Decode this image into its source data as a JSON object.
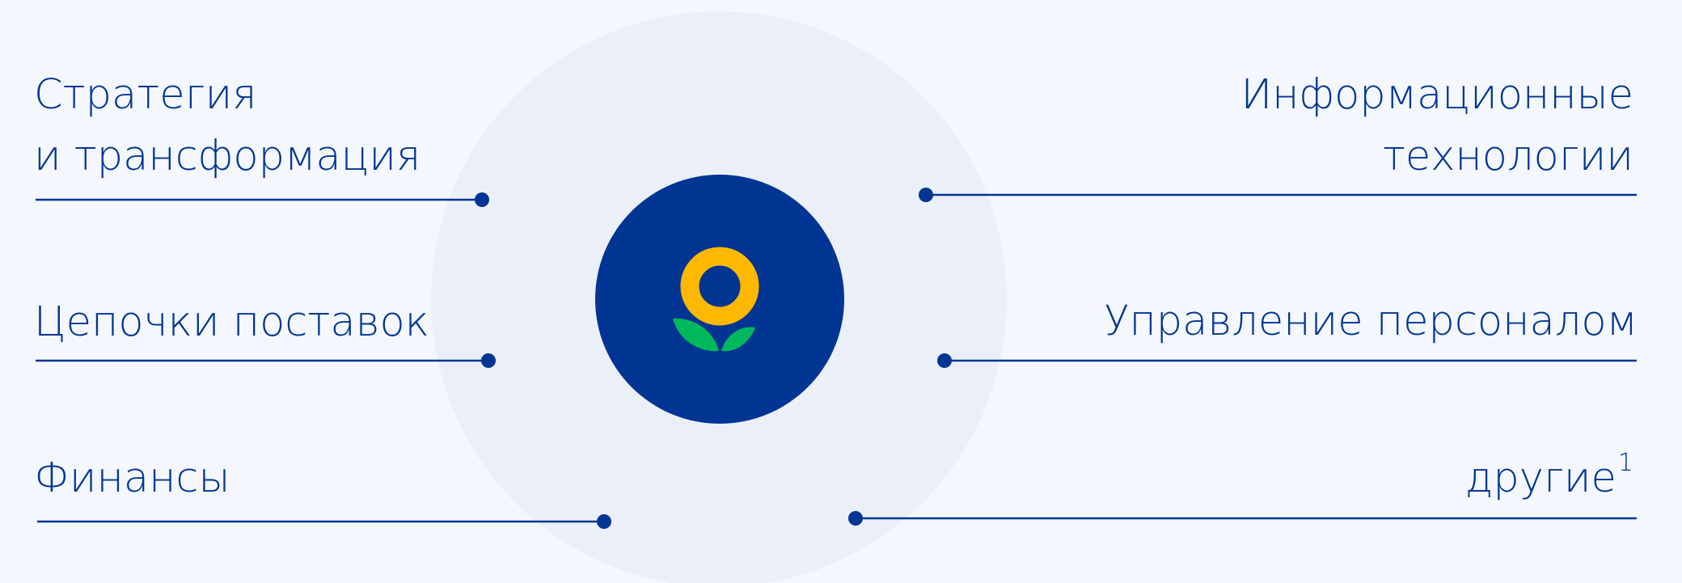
{
  "labels": {
    "strategy": [
      "Стратегия",
      "и трансформация"
    ],
    "supply_chain": "Цепочки поставок",
    "finance": "Финансы",
    "it": [
      "Информационные",
      "технологии"
    ],
    "hr": "Управление персоналом",
    "other": "другие",
    "other_footnote": "1"
  },
  "colors": {
    "background": "#F4F8FE",
    "circle": "#EBF0F8",
    "brand_blue": "#003594",
    "logo_yellow": "#FFB800",
    "logo_green": "#00B85C"
  },
  "icons": {
    "center_logo": "flower-logo-icon"
  }
}
